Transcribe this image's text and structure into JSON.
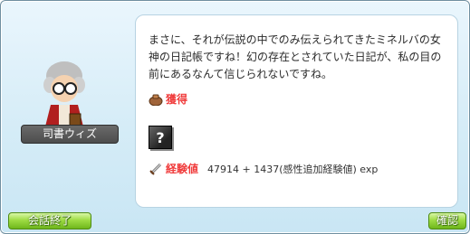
{
  "npc": {
    "name": "司書ウィズ"
  },
  "dialog": {
    "message_lines": [
      "まさに、それが伝説の中でのみ伝えられてきたミネルバの女",
      "神の日記帳ですね！幻の存在とされていた日記が、私の目の",
      "前にあるなんて信じられないですね。"
    ],
    "gain_label": "獲得",
    "item_icon": "unknown-item-icon",
    "exp_label": "経験値",
    "exp_value": "47914 + 1437(感性追加経験値) exp"
  },
  "buttons": {
    "end_chat": "会話終了",
    "confirm": "確認"
  },
  "colors": {
    "accent_red": "#f03c3c",
    "button_green": "#9fdc44",
    "frame_blue": "#d5ecf7"
  }
}
